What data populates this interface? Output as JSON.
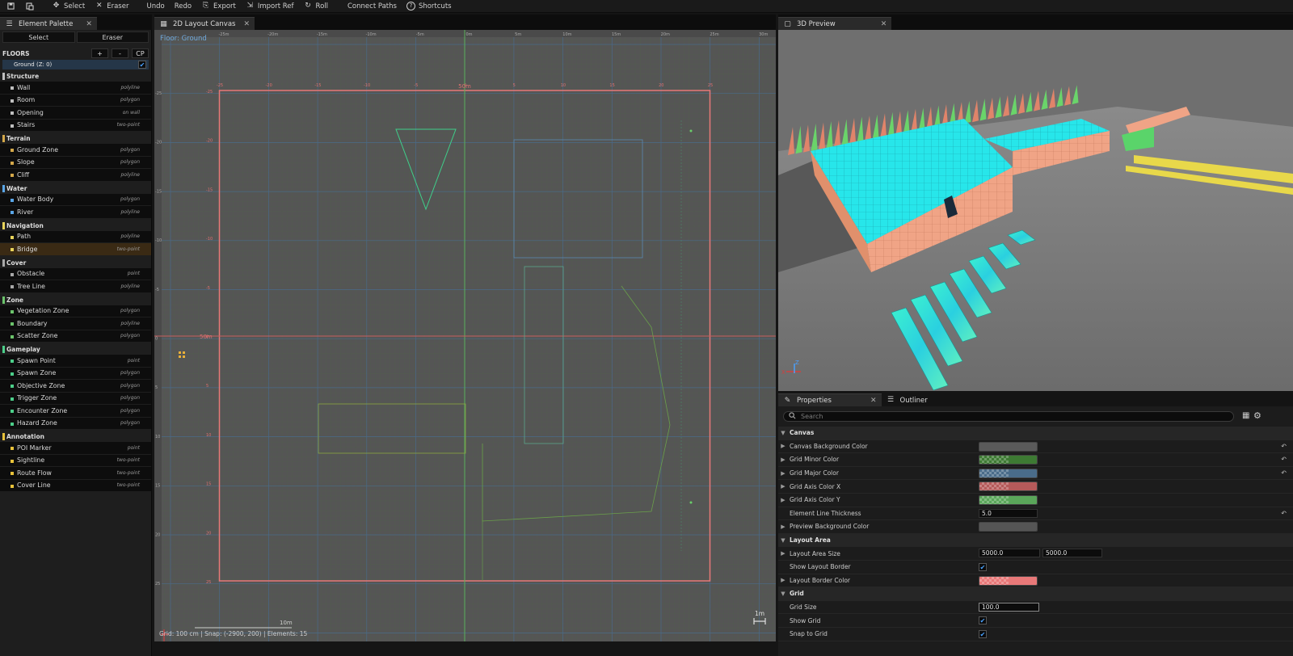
{
  "toolbar": {
    "items": [
      {
        "label": "Select",
        "icon": "move-icon"
      },
      {
        "label": "Eraser",
        "icon": "eraser-icon"
      },
      {
        "label": "Undo",
        "icon": "undo-icon"
      },
      {
        "label": "Redo",
        "icon": "redo-icon"
      },
      {
        "label": "Export",
        "icon": "export-icon"
      },
      {
        "label": "Import Ref",
        "icon": "import-icon"
      },
      {
        "label": "Roll",
        "icon": "roll-icon"
      },
      {
        "label": "Connect Paths",
        "icon": "connect-icon"
      },
      {
        "label": "Shortcuts",
        "icon": "help-icon"
      }
    ]
  },
  "palette": {
    "tab_label": "Element Palette",
    "select_label": "Select",
    "eraser_label": "Eraser",
    "floors_title": "FLOORS",
    "add_floor": "+",
    "remove_floor": "-",
    "cp_label": "CP",
    "floor_name": "Ground  (Z: 0)",
    "categories": [
      {
        "name": "Structure",
        "color": "#bfbfbf",
        "items": [
          {
            "label": "Wall",
            "type": "polyline"
          },
          {
            "label": "Room",
            "type": "polygon"
          },
          {
            "label": "Opening",
            "type": "on wall"
          },
          {
            "label": "Stairs",
            "type": "two-point"
          }
        ]
      },
      {
        "name": "Terrain",
        "color": "#d4a84a",
        "items": [
          {
            "label": "Ground Zone",
            "type": "polygon"
          },
          {
            "label": "Slope",
            "type": "polygon"
          },
          {
            "label": "Cliff",
            "type": "polyline"
          }
        ]
      },
      {
        "name": "Water",
        "color": "#5aa6e8",
        "items": [
          {
            "label": "Water Body",
            "type": "polygon"
          },
          {
            "label": "River",
            "type": "polyline"
          }
        ]
      },
      {
        "name": "Navigation",
        "color": "#e8d35a",
        "items": [
          {
            "label": "Path",
            "type": "polyline"
          },
          {
            "label": "Bridge",
            "type": "two-point"
          }
        ]
      },
      {
        "name": "Cover",
        "color": "#a8a8a8",
        "items": [
          {
            "label": "Obstacle",
            "type": "point"
          },
          {
            "label": "Tree Line",
            "type": "polyline"
          }
        ]
      },
      {
        "name": "Zone",
        "color": "#6cc46c",
        "items": [
          {
            "label": "Vegetation Zone",
            "type": "polygon"
          },
          {
            "label": "Boundary",
            "type": "polyline"
          },
          {
            "label": "Scatter Zone",
            "type": "polygon"
          }
        ]
      },
      {
        "name": "Gameplay",
        "color": "#4ccf8a",
        "items": [
          {
            "label": "Spawn Point",
            "type": "point"
          },
          {
            "label": "Spawn Zone",
            "type": "polygon"
          },
          {
            "label": "Objective Zone",
            "type": "polygon"
          },
          {
            "label": "Trigger Zone",
            "type": "polygon"
          },
          {
            "label": "Encounter Zone",
            "type": "polygon"
          },
          {
            "label": "Hazard Zone",
            "type": "polygon"
          }
        ]
      },
      {
        "name": "Annotation",
        "color": "#e8c23a",
        "items": [
          {
            "label": "POI Marker",
            "type": "point"
          },
          {
            "label": "Sightline",
            "type": "two-point"
          },
          {
            "label": "Route Flow",
            "type": "two-point"
          },
          {
            "label": "Cover Line",
            "type": "two-point"
          }
        ]
      }
    ]
  },
  "canvas": {
    "tab_label": "2D Layout Canvas",
    "floor_label": "Floor: Ground",
    "center_label": "50m",
    "left_axis_label": "50m",
    "scale_label": "10m",
    "corner_label": "1m",
    "status": "Grid: 100 cm  |  Snap: (-2900, 200)  |  Elements: 15",
    "top_ruler": [
      "-25m",
      "-20m",
      "-15m",
      "-10m",
      "-5m",
      "0m",
      "5m",
      "10m",
      "15m",
      "20m",
      "25m",
      "30m"
    ],
    "inner_ruler": [
      "-25",
      "-20",
      "-15",
      "-10",
      "-5",
      "0",
      "5",
      "10",
      "15",
      "20",
      "25"
    ],
    "left_ruler": [
      "-25",
      "-20",
      "-15",
      "-10",
      "-5",
      "0",
      "5",
      "10",
      "15",
      "20",
      "25"
    ]
  },
  "preview": {
    "tab_label": "3D Preview",
    "axis_x": "X",
    "axis_z": "Z"
  },
  "properties": {
    "tab_label": "Properties",
    "outliner_label": "Outliner",
    "search_placeholder": "Search",
    "rows": [
      {
        "kind": "section",
        "label": "Canvas"
      },
      {
        "kind": "color",
        "label": "Canvas Background Color",
        "color": "#5a5a5a",
        "checker": false,
        "reset": true
      },
      {
        "kind": "color",
        "label": "Grid Minor Color",
        "color": "#3d7a33",
        "checker": true,
        "reset": true
      },
      {
        "kind": "color",
        "label": "Grid Major Color",
        "color": "#4a6c8a",
        "checker": true,
        "reset": true
      },
      {
        "kind": "color",
        "label": "Grid Axis Color X",
        "color": "#b55a5a",
        "checker": true,
        "reset": false
      },
      {
        "kind": "color",
        "label": "Grid Axis Color Y",
        "color": "#5aa65a",
        "checker": true,
        "reset": false
      },
      {
        "kind": "number",
        "label": "Element Line Thickness",
        "value": "5.0",
        "reset": true
      },
      {
        "kind": "color",
        "label": "Preview Background Color",
        "color": "#555555",
        "checker": false,
        "reset": false
      },
      {
        "kind": "section",
        "label": "Layout Area"
      },
      {
        "kind": "vector",
        "label": "Layout Area Size",
        "value": "5000.0",
        "value2": "5000.0"
      },
      {
        "kind": "check",
        "label": "Show Layout Border",
        "checked": true
      },
      {
        "kind": "color",
        "label": "Layout Border Color",
        "color": "#e87878",
        "checker": true,
        "reset": false
      },
      {
        "kind": "section",
        "label": "Grid"
      },
      {
        "kind": "number",
        "label": "Grid Size",
        "value": "100.0",
        "reset": false
      },
      {
        "kind": "check",
        "label": "Show Grid",
        "checked": true
      },
      {
        "kind": "check",
        "label": "Snap to Grid",
        "checked": true
      }
    ]
  }
}
